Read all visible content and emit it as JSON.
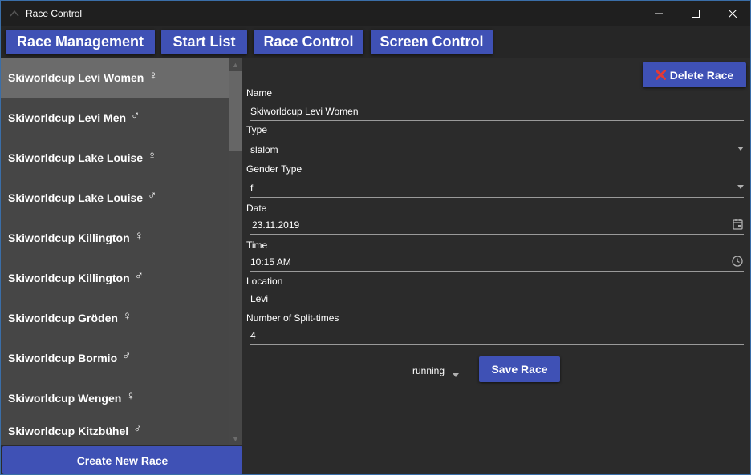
{
  "window": {
    "title": "Race Control"
  },
  "nav": {
    "items": [
      "Race Management",
      "Start List",
      "Race Control",
      "Screen Control"
    ]
  },
  "races": [
    {
      "name": "Skiworldcup Levi Women",
      "gender": "♀"
    },
    {
      "name": "Skiworldcup Levi Men",
      "gender": "♂"
    },
    {
      "name": "Skiworldcup Lake Louise",
      "gender": "♀"
    },
    {
      "name": "Skiworldcup Lake Louise",
      "gender": "♂"
    },
    {
      "name": "Skiworldcup Killington",
      "gender": "♀"
    },
    {
      "name": "Skiworldcup Killington",
      "gender": "♂"
    },
    {
      "name": "Skiworldcup Gröden",
      "gender": "♀"
    },
    {
      "name": "Skiworldcup Bormio",
      "gender": "♂"
    },
    {
      "name": "Skiworldcup Wengen",
      "gender": "♀"
    },
    {
      "name": "Skiworldcup Kitzbühel",
      "gender": "♂"
    }
  ],
  "sidebar": {
    "create_label": "Create New Race"
  },
  "form": {
    "delete_label": "Delete Race",
    "name_label": "Name",
    "name_value": "Skiworldcup Levi Women",
    "type_label": "Type",
    "type_value": "slalom",
    "gender_label": "Gender Type",
    "gender_value": "f",
    "date_label": "Date",
    "date_value": "23.11.2019",
    "time_label": "Time",
    "time_value": "10:15 AM",
    "location_label": "Location",
    "location_value": "Levi",
    "splits_label": "Number of Split-times",
    "splits_value": "4",
    "status_value": "running",
    "save_label": "Save Race"
  },
  "colors": {
    "accent": "#3f51b5",
    "delete_icon": "#e53935"
  }
}
